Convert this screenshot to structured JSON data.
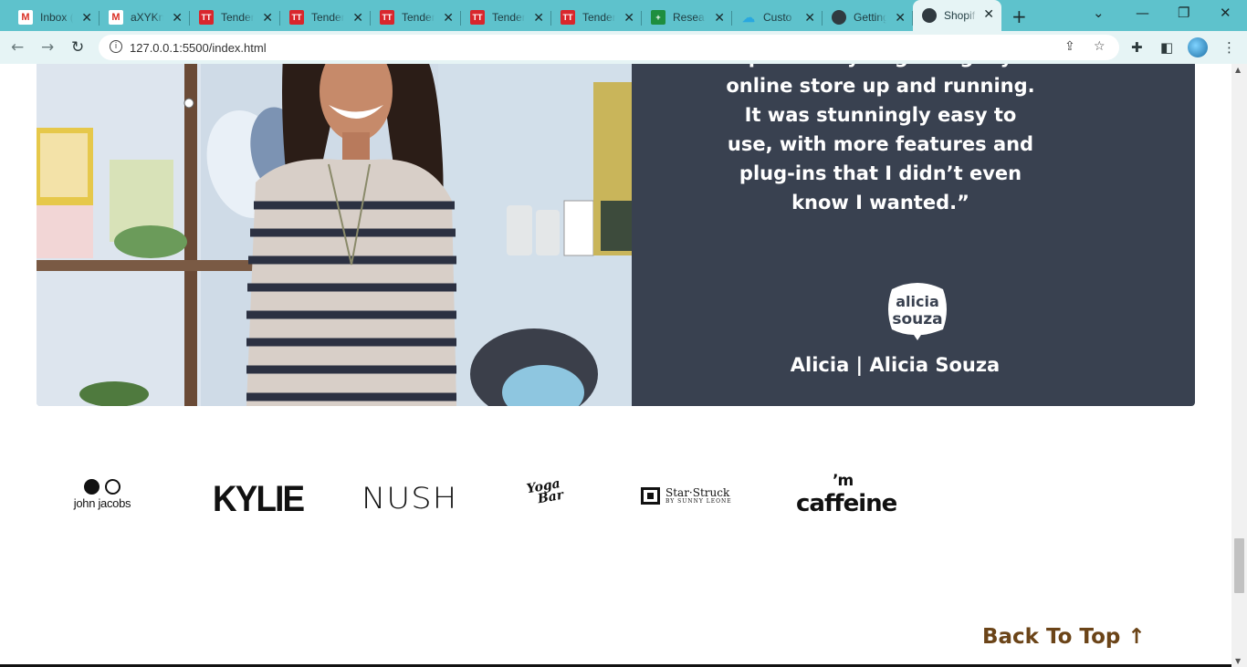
{
  "browser": {
    "tabs": [
      {
        "title": "Inbox (",
        "icon": "gmail-icon",
        "icon_text": "M",
        "kind": "gm"
      },
      {
        "title": "aXYKn",
        "icon": "gmail-icon",
        "icon_text": "M",
        "kind": "gm"
      },
      {
        "title": "Tender",
        "icon": "tt-icon",
        "icon_text": "TT",
        "kind": "tt"
      },
      {
        "title": "Tender",
        "icon": "tt-icon",
        "icon_text": "TT",
        "kind": "tt"
      },
      {
        "title": "Tender",
        "icon": "tt-icon",
        "icon_text": "TT",
        "kind": "tt"
      },
      {
        "title": "Tender",
        "icon": "tt-icon",
        "icon_text": "TT",
        "kind": "tt"
      },
      {
        "title": "Tender",
        "icon": "tt-icon",
        "icon_text": "TT",
        "kind": "tt"
      },
      {
        "title": "Resear",
        "icon": "sheets-icon",
        "icon_text": "+",
        "kind": "sh"
      },
      {
        "title": "Custo",
        "icon": "cloud-icon",
        "icon_text": "☁",
        "kind": "cu"
      },
      {
        "title": "Getting",
        "icon": "globe-icon",
        "icon_text": "",
        "kind": "gl"
      },
      {
        "title": "Shopif",
        "icon": "globe-icon",
        "icon_text": "",
        "kind": "gl",
        "active": true
      }
    ],
    "url": "127.0.0.1:5500/index.html"
  },
  "testimonial": {
    "quote_lines": [
      "possibility of getting my",
      "online store up and running.",
      "It was stunningly easy to",
      "use, with more features and",
      "plug-ins that I didn’t even",
      "know I wanted.”"
    ],
    "brand_badge_lines": [
      "alicia",
      "souza"
    ],
    "author": "Alicia | Alicia Souza",
    "panel_color": "#394150"
  },
  "brand_logos": {
    "john_jacobs": "john jacobs",
    "kylie": "KYLIE",
    "nush": "NUSH",
    "yoga_bar_lines": [
      "Yoga",
      "Bar"
    ],
    "star_struck": "Star·Struck",
    "star_struck_sub": "BY SUNNY LEONE",
    "im_caffeine_sup": "’m",
    "im_caffeine": "caffeine"
  },
  "back_to_top": "Back To Top ↑",
  "colors": {
    "accent": "#6b4418",
    "tabstrip": "#5ec2cc"
  }
}
